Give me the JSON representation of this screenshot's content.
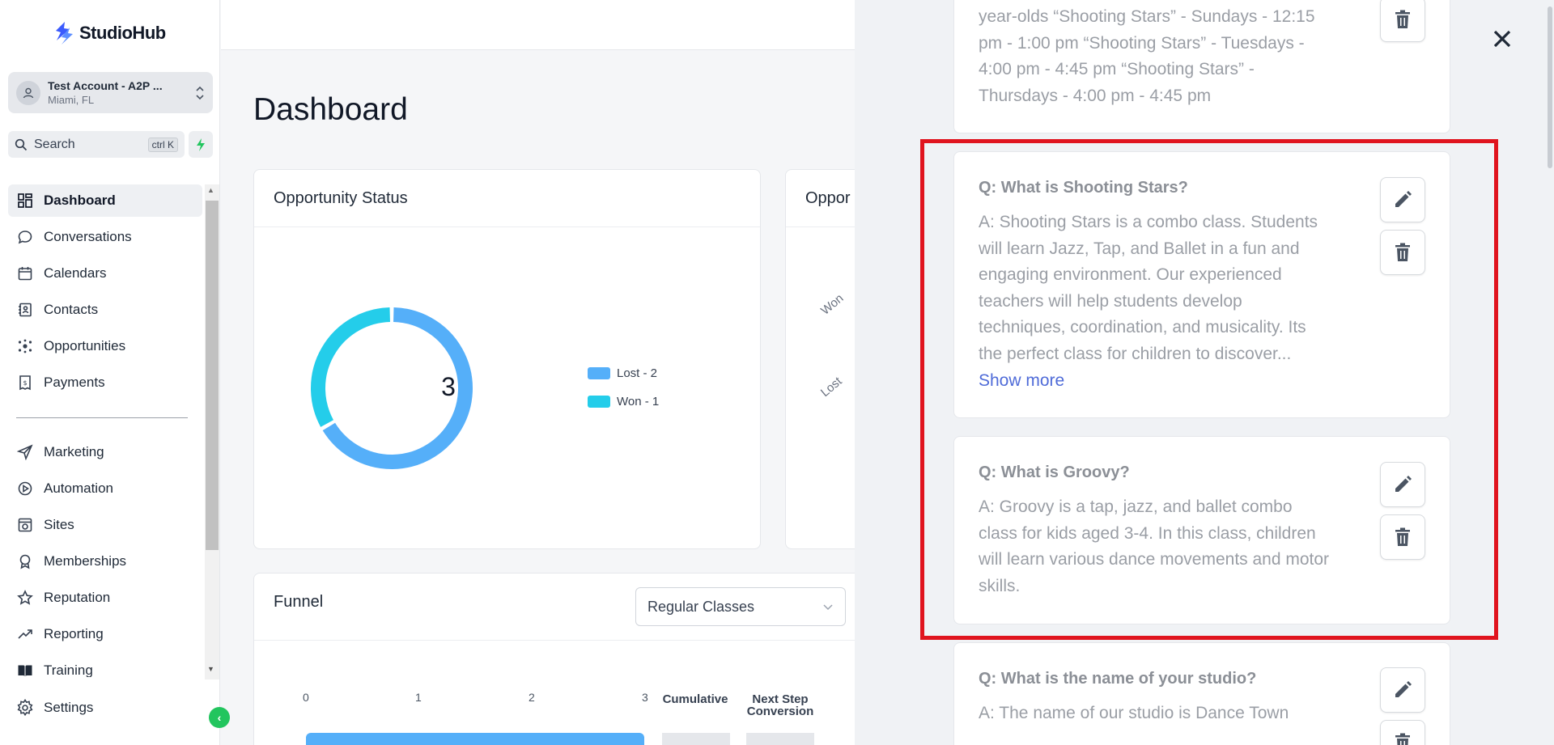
{
  "brand": {
    "name": "StudioHub",
    "accent": "#3b5bfd"
  },
  "account": {
    "name": "Test Account - A2P ...",
    "location": "Miami, FL"
  },
  "search": {
    "label": "Search",
    "shortcut": "ctrl K"
  },
  "nav": {
    "items": [
      {
        "label": "Dashboard",
        "icon": "dashboard-icon",
        "active": true
      },
      {
        "label": "Conversations",
        "icon": "chat-icon"
      },
      {
        "label": "Calendars",
        "icon": "calendar-icon"
      },
      {
        "label": "Contacts",
        "icon": "contacts-icon"
      },
      {
        "label": "Opportunities",
        "icon": "opportunities-icon"
      },
      {
        "label": "Payments",
        "icon": "payments-icon"
      },
      {
        "label": "Marketing",
        "icon": "send-icon"
      },
      {
        "label": "Automation",
        "icon": "automation-icon"
      },
      {
        "label": "Sites",
        "icon": "sites-icon"
      },
      {
        "label": "Memberships",
        "icon": "badge-icon"
      },
      {
        "label": "Reputation",
        "icon": "star-icon"
      },
      {
        "label": "Reporting",
        "icon": "trend-icon"
      },
      {
        "label": "Training",
        "icon": "book-icon"
      }
    ],
    "settings": "Settings"
  },
  "main": {
    "title": "Dashboard",
    "opportunity_status": {
      "title": "Opportunity Status",
      "total": "3",
      "legend": [
        "Lost - 2",
        "Won - 1"
      ]
    },
    "opportunity_value": {
      "title": "Oppor",
      "labels": [
        "Won",
        "Lost"
      ]
    },
    "funnel": {
      "title": "Funnel",
      "pipeline": "Regular Classes",
      "ticks": [
        "0",
        "1",
        "2",
        "3"
      ],
      "cumulative": "Cumulative",
      "next_step": "Next Step Conversion"
    }
  },
  "chart_data": {
    "type": "pie",
    "categories": [
      "Lost",
      "Won"
    ],
    "values": [
      2,
      1
    ],
    "colors": [
      "#55aff9",
      "#24cdea"
    ]
  },
  "drawer": {
    "qa": [
      {
        "question": "",
        "answer": "year-olds “Shooting Stars” - Sundays - 12:15 pm - 1:00 pm “Shooting Stars” - Tuesdays - 4:00 pm - 4:45 pm “Shooting Stars” - Thursdays - 4:00 pm - 4:45 pm"
      },
      {
        "question": "Q: What is Shooting Stars?",
        "answer": "A: Shooting Stars is a combo class. Students will learn Jazz, Tap, and Ballet in a fun and engaging environment. Our experienced teachers will help students develop techniques, coordination, and musicality. Its the perfect class for children to discover...",
        "more": "Show more"
      },
      {
        "question": "Q: What is Groovy?",
        "answer": "A: Groovy is a tap, jazz, and ballet combo class for kids aged 3-4. In this class, children will learn various dance movements and motor skills."
      },
      {
        "question": "Q: What is the name of your studio?",
        "answer": "A: The name of our studio is Dance Town"
      }
    ]
  }
}
